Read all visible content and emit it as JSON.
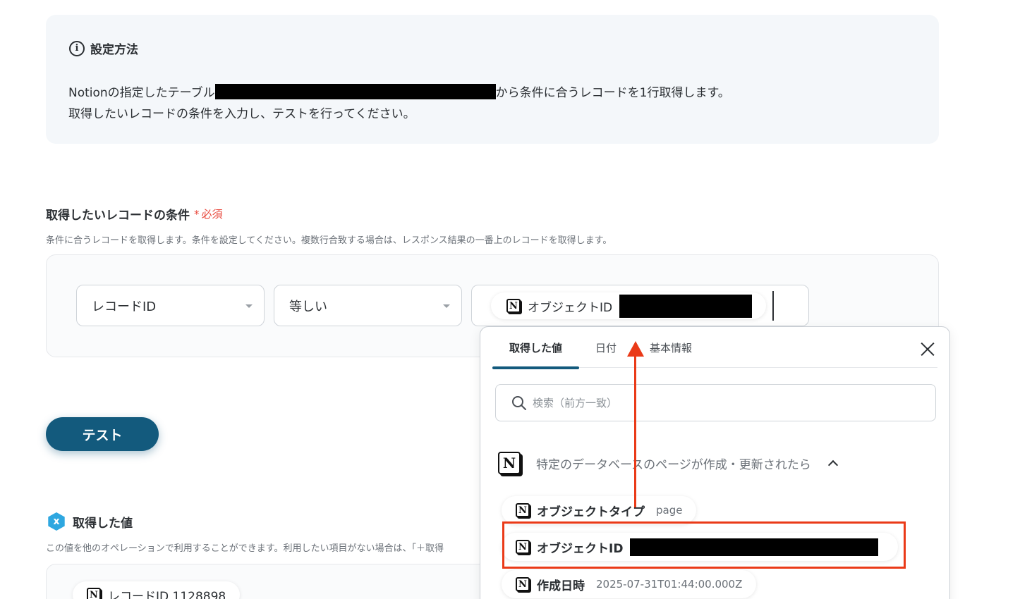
{
  "info": {
    "title": "設定方法",
    "icon": "info-icon",
    "line1_prefix": "Notionの指定したテーブル",
    "line1_suffix": "から条件に合うレコードを1行取得します。",
    "line2": "取得したいレコードの条件を入力し、テストを行ってください。"
  },
  "condition": {
    "title": "取得したいレコードの条件",
    "required_mark": "*",
    "required_label": "必須",
    "description": "条件に合うレコードを取得します。条件を設定してください。複数行合致する場合は、レスポンス結果の一番上のレコードを取得します。",
    "field_select": "レコードID",
    "operator_select": "等しい",
    "value_chip_label": "オブジェクトID"
  },
  "test_button": "テスト",
  "acquired": {
    "title": "取得した値",
    "description": "この値を他のオペレーションで利用することができます。利用したい項目がない場合は、「＋取得",
    "first_item": "レコードID 1128898"
  },
  "popup": {
    "tabs": [
      "取得した値",
      "日付",
      "基本情報"
    ],
    "search_placeholder": "検索（前方一致）",
    "group_title": "特定のデータベースのページが作成・更新されたら",
    "items": [
      {
        "label": "オブジェクトタイプ",
        "value": "page"
      },
      {
        "label": "オブジェクトID",
        "value": ""
      },
      {
        "label": "作成日時",
        "value": "2025-07-31T01:44:00.000Z"
      }
    ]
  },
  "colors": {
    "accent": "#135a7d",
    "annotation": "#ea3a18",
    "required": "#e8473b",
    "icon_blue": "#2ea7e0"
  }
}
